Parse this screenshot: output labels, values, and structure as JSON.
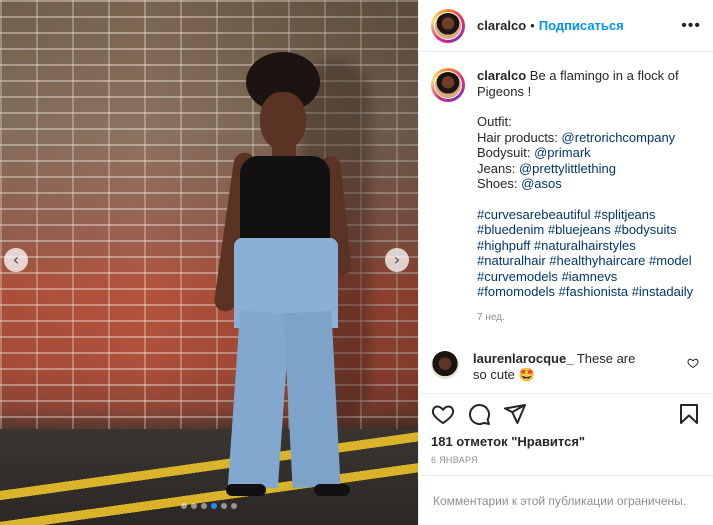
{
  "post": {
    "username": "claralco",
    "follow_label": "Подписаться",
    "caption_lines": [
      "Be a flamingo in a flock of Pigeons !"
    ],
    "outfit": {
      "heading": "Outfit:",
      "hair_label": "Hair products:",
      "hair_tag": "@retrorichcompany",
      "bodysuit_label": "Bodysuit:",
      "bodysuit_tag": "@primark",
      "jeans_label": "Jeans:",
      "jeans_tag": "@prettylittlething",
      "shoes_label": "Shoes:",
      "shoes_tag": "@asos"
    },
    "hashtags": [
      "#curvesarebeautiful",
      "#splitjeans",
      "#bluedenim",
      "#bluejeans",
      "#bodysuits",
      "#highpuff",
      "#naturalhairstyles",
      "#naturalhair",
      "#healthyhaircare",
      "#model",
      "#curvemodels",
      "#iamnevs",
      "#fomomodels",
      "#fashionista",
      "#instadaily"
    ],
    "time_ago": "7 нед.",
    "comment": {
      "username": "laurenlarocque_",
      "text": "These are so cute",
      "emoji": "🤩"
    },
    "likes_text": "181 отметок \"Нравится\"",
    "date_text": "6 ЯНВАРЯ",
    "comments_disabled_text": "Комментарии к этой публикации ограничены.",
    "carousel": {
      "slides": 6,
      "active_index": 3
    }
  },
  "icons": {
    "more": "more-options-icon",
    "like": "heart-icon",
    "comment": "comment-icon",
    "share": "share-icon",
    "save": "bookmark-icon",
    "prev": "chevron-left-icon",
    "next": "chevron-right-icon"
  },
  "colors": {
    "link": "#00376b",
    "follow": "#0095f6",
    "muted": "#8e8e8e",
    "active_dot": "#1f8ff3"
  }
}
